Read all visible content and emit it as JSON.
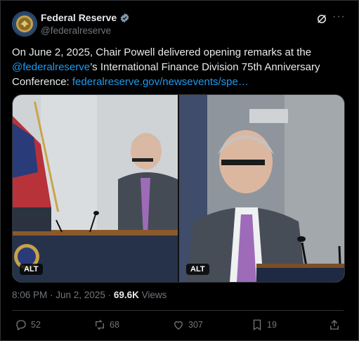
{
  "account": {
    "name": "Federal Reserve",
    "handle": "@federalreserve",
    "verified": true
  },
  "tweet": {
    "text_before": "On June 2, 2025, Chair Powell delivered opening remarks at the ",
    "mention": "@federalreserve",
    "text_after": "’s International Finance Division 75th Anniversary Conference: ",
    "link": "federalreserve.gov/newsevents/spe…"
  },
  "media": {
    "alt_labels": [
      "ALT",
      "ALT"
    ]
  },
  "meta": {
    "time": "8:06 PM · Jun 2, 2025 · ",
    "views_count": "69.6K",
    "views_label": " Views"
  },
  "actions": {
    "replies": "52",
    "reposts": "68",
    "likes": "307",
    "bookmarks": "19"
  },
  "icons": [
    "verified-badge-icon",
    "grok-icon",
    "more-icon",
    "reply-icon",
    "repost-icon",
    "like-icon",
    "bookmark-icon",
    "share-icon"
  ],
  "colors": {
    "link": "#1d9bf0",
    "muted": "#71767b",
    "text": "#e7e9ea",
    "background": "#000000"
  }
}
